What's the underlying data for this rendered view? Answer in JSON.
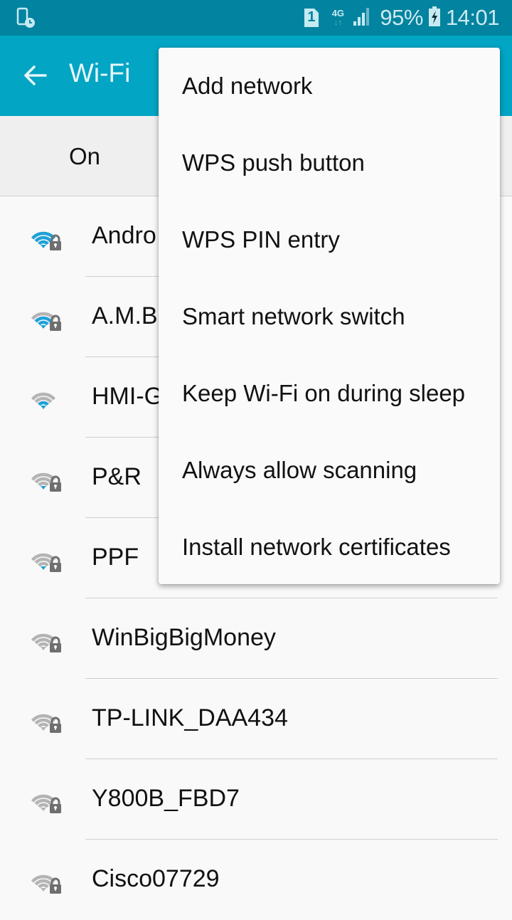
{
  "status_bar": {
    "left_icon": "device-schedule-icon",
    "sim_slot": "1",
    "network_type": "4G",
    "signal_icon": "cell-signal-icon",
    "battery_percent": "95%",
    "battery_icon": "battery-charging-icon",
    "time": "14:01"
  },
  "app_bar": {
    "back_icon": "arrow-back-icon",
    "title": "Wi-Fi"
  },
  "master_switch": {
    "label": "On"
  },
  "colors": {
    "status_bar": "#02839f",
    "app_bar": "#02a5c4",
    "wifi_active": "#1ea1d8",
    "wifi_inactive": "#b4b4b4",
    "lock": "#6f6f6f"
  },
  "networks": [
    {
      "name": "AndroidAP",
      "visible_text": "Andro",
      "signal_level": 4,
      "secured": true
    },
    {
      "name": "A.M.B",
      "visible_text": "A.M.B",
      "signal_level": 3,
      "secured": true
    },
    {
      "name": "HMI-G",
      "visible_text": "HMI-G",
      "signal_level": 2,
      "secured": false
    },
    {
      "name": "P&R",
      "visible_text": "P&R",
      "signal_level": 1,
      "secured": true
    },
    {
      "name": "PPF",
      "visible_text": "PPF",
      "signal_level": 1,
      "secured": true
    },
    {
      "name": "WinBigBigMoney",
      "visible_text": "WinBigBigMoney",
      "signal_level": 0,
      "secured": true
    },
    {
      "name": "TP-LINK_DAA434",
      "visible_text": "TP-LINK_DAA434",
      "signal_level": 0,
      "secured": true
    },
    {
      "name": "Y800B_FBD7",
      "visible_text": "Y800B_FBD7",
      "signal_level": 0,
      "secured": true
    },
    {
      "name": "Cisco07729",
      "visible_text": "Cisco07729",
      "signal_level": 0,
      "secured": true
    }
  ],
  "overflow_menu": {
    "items": [
      {
        "label": "Add network"
      },
      {
        "label": "WPS push button"
      },
      {
        "label": "WPS PIN entry"
      },
      {
        "label": "Smart network switch"
      },
      {
        "label": "Keep Wi-Fi on during sleep"
      },
      {
        "label": "Always allow scanning"
      },
      {
        "label": "Install network certificates"
      }
    ]
  }
}
